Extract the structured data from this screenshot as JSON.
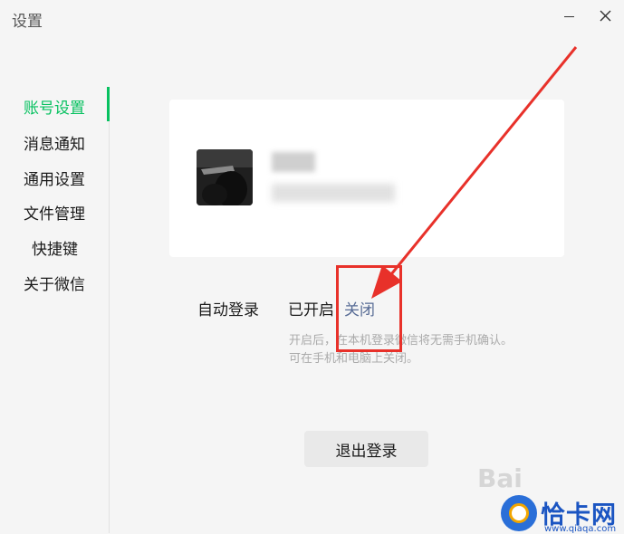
{
  "window": {
    "title": "设置"
  },
  "sidebar": {
    "items": [
      {
        "label": "账号设置",
        "active": true
      },
      {
        "label": "消息通知",
        "active": false
      },
      {
        "label": "通用设置",
        "active": false
      },
      {
        "label": "文件管理",
        "active": false
      },
      {
        "label": "快捷键",
        "active": false
      },
      {
        "label": "关于微信",
        "active": false
      }
    ]
  },
  "auto_login": {
    "label": "自动登录",
    "status": "已开启",
    "action": "关闭",
    "description_line1": "开启后，在本机登录微信将无需手机确认。",
    "description_line2": "可在手机和电脑上关闭。"
  },
  "logout": {
    "label": "退出登录"
  },
  "watermark": {
    "text": "Bai",
    "site": "恰卡网",
    "domain": "www.qiaqa.com"
  },
  "colors": {
    "accent": "#07c160",
    "link": "#576b95",
    "annotation": "#e8312a",
    "background": "#f5f5f5"
  }
}
